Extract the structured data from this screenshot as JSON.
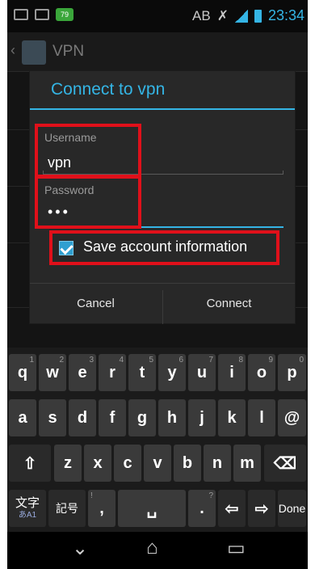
{
  "status_bar": {
    "badge": "79",
    "carrier": "AB",
    "time": "23:34"
  },
  "background_app": {
    "back": "‹",
    "title": "VPN"
  },
  "dialog": {
    "title": "Connect to vpn",
    "username_label": "Username",
    "username_value": "vpn",
    "password_label": "Password",
    "password_value": "•••",
    "save_label": "Save account information",
    "save_checked": true,
    "cancel_label": "Cancel",
    "connect_label": "Connect"
  },
  "keyboard": {
    "row1": [
      {
        "key": "q",
        "hint": "1"
      },
      {
        "key": "w",
        "hint": "2"
      },
      {
        "key": "e",
        "hint": "3"
      },
      {
        "key": "r",
        "hint": "4"
      },
      {
        "key": "t",
        "hint": "5"
      },
      {
        "key": "y",
        "hint": "6"
      },
      {
        "key": "u",
        "hint": "7"
      },
      {
        "key": "i",
        "hint": "8"
      },
      {
        "key": "o",
        "hint": "9"
      },
      {
        "key": "p",
        "hint": "0"
      }
    ],
    "row2": [
      "a",
      "s",
      "d",
      "f",
      "g",
      "h",
      "j",
      "k",
      "l",
      "@"
    ],
    "row3": [
      "⇧",
      "z",
      "x",
      "c",
      "v",
      "b",
      "n",
      "m",
      "⌫"
    ],
    "row4": {
      "lang": "文字",
      "lang_sub": "あA1",
      "symbols": "記号",
      "comma": ",",
      "comma_hint": "!",
      "space": "␣",
      "period": ".",
      "period_hint": "?",
      "left": "⇦",
      "right": "⇨",
      "done": "Done"
    }
  },
  "navbar": {
    "back": "⌄",
    "home": "⌂",
    "recents": "▭"
  },
  "colors": {
    "accent": "#34b5e5",
    "highlight": "#e0101a"
  }
}
